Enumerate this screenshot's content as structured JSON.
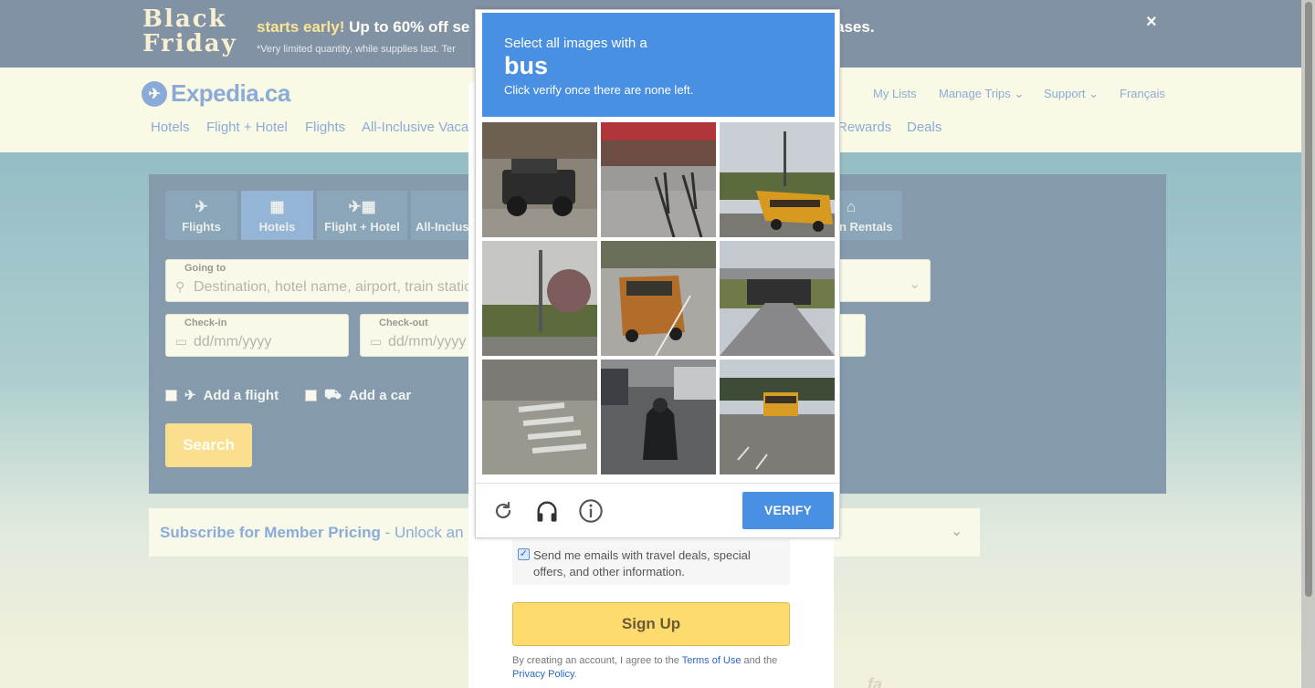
{
  "promo": {
    "logo_line1": "Black",
    "logo_line2": "Friday",
    "headline_accent": "starts early!",
    "headline_rest": "Up to 60% off se",
    "headline_end": "ases.",
    "fine_print": "*Very limited quantity, while supplies last. Ter",
    "close": "×"
  },
  "brand": {
    "name": "Expedia.ca"
  },
  "user_nav": [
    "My Lists",
    "Manage Trips",
    "Support",
    "Français"
  ],
  "main_nav": [
    "Hotels",
    "Flight + Hotel",
    "Flights",
    "All-Inclusive Vaca",
    "Rewards",
    "Deals"
  ],
  "search": {
    "tabs": [
      {
        "label": "Flights",
        "icon": "plane-icon"
      },
      {
        "label": "Hotels",
        "icon": "building-icon"
      },
      {
        "label": "Flight + Hotel",
        "icon": "plane-building-icon"
      },
      {
        "label": "All-Inclus",
        "icon": "beach-icon"
      },
      {
        "label": "n Rentals",
        "icon": "house-icon"
      }
    ],
    "going_to_label": "Going to",
    "going_to_placeholder": "Destination, hotel name, airport, train statio",
    "checkin_label": "Check-in",
    "checkin_placeholder": "dd/mm/yyyy",
    "checkout_label": "Check-out",
    "checkout_placeholder": "dd/mm/yyyy",
    "add_flight": "Add a flight",
    "add_car": "Add a car",
    "search_button": "Search"
  },
  "subscribe": {
    "bold": "Subscribe for Member Pricing",
    "rest": " - Unlock an"
  },
  "signup": {
    "optin_checked": true,
    "optin_text": "Send me emails with travel deals, special offers, and other information.",
    "button": "Sign Up",
    "terms_prefix": "By creating an account, I agree to the ",
    "terms_link": "Terms of Use",
    "terms_mid": " and the",
    "privacy_link": "Privacy Policy",
    "terms_suffix": "."
  },
  "captcha": {
    "instruction": "Select all images with a",
    "target": "bus",
    "hint": "Click verify once there are none left.",
    "verify_button": "VERIFY",
    "tools": [
      "refresh-icon",
      "headphones-icon",
      "info-icon"
    ],
    "tiles": [
      {
        "subject": "black jeep on street",
        "selected": false
      },
      {
        "subject": "storefront with bicycles",
        "selected": false
      },
      {
        "subject": "school bus on road",
        "selected": false
      },
      {
        "subject": "trees by road",
        "selected": false
      },
      {
        "subject": "orange truck on road",
        "selected": false
      },
      {
        "subject": "highway overpass",
        "selected": false
      },
      {
        "subject": "crosswalk",
        "selected": false
      },
      {
        "subject": "motorcycle in traffic",
        "selected": false
      },
      {
        "subject": "school bus on highway",
        "selected": false
      }
    ]
  },
  "colors": {
    "captcha_blue": "#4a90e2",
    "expedia_blue": "#2a67c4",
    "signup_yellow": "#fddb6d",
    "promo_navy": "#1d3a68"
  }
}
